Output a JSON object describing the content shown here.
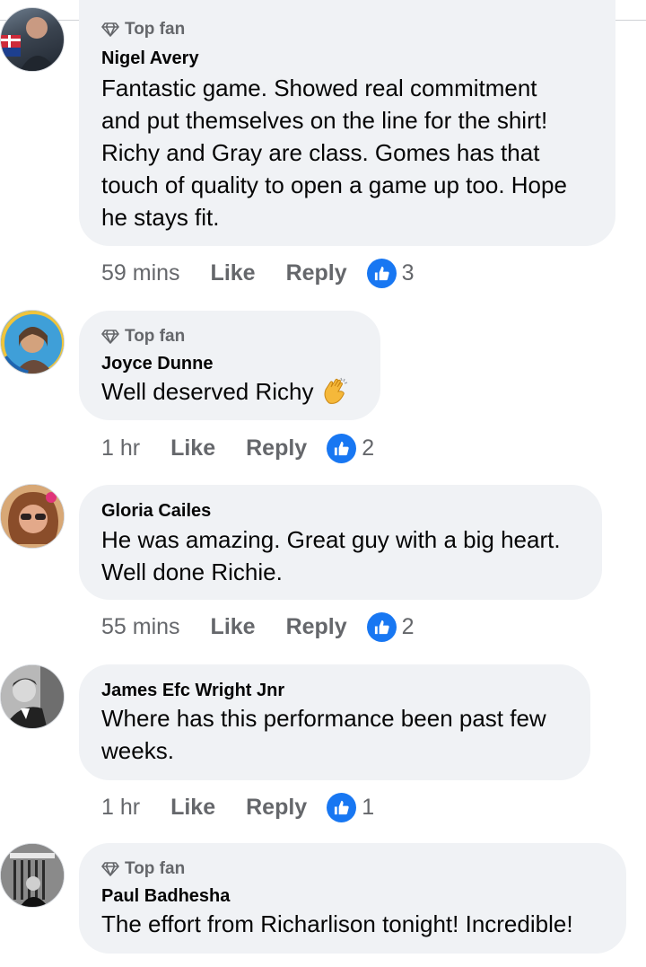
{
  "colors": {
    "bubble": "#f0f2f5",
    "like_blue": "#1877f2",
    "muted": "#65676b",
    "text": "#050505"
  },
  "comments": [
    {
      "badge": "Top fan",
      "author": "Nigel Avery",
      "lines": [
        "Fantastic game. Showed real commitment",
        "and put themselves on the line for the shirt!",
        "Richy and Gray are class. Gomes has that",
        "touch of quality to open a game up too. Hope",
        "he stays fit."
      ],
      "time": "59 mins",
      "like_label": "Like",
      "reply_label": "Reply",
      "likes": "3"
    },
    {
      "badge": "Top fan",
      "author": "Joyce Dunne",
      "lines": [
        "Well deserved Richy"
      ],
      "emoji": "clapping-hands-icon",
      "time": "1 hr",
      "like_label": "Like",
      "reply_label": "Reply",
      "likes": "2"
    },
    {
      "author": "Gloria Cailes",
      "lines": [
        "He was amazing. Great guy with a big heart.",
        "Well done Richie."
      ],
      "time": "55 mins",
      "like_label": "Like",
      "reply_label": "Reply",
      "likes": "2"
    },
    {
      "author": "James Efc Wright Jnr",
      "lines": [
        "Where has this performance been past few",
        "weeks."
      ],
      "time": "1 hr",
      "like_label": "Like",
      "reply_label": "Reply",
      "likes": "1"
    },
    {
      "badge": "Top fan",
      "author": "Paul Badhesha",
      "lines": [
        "The effort from Richarlison tonight! Incredible!"
      ]
    }
  ]
}
